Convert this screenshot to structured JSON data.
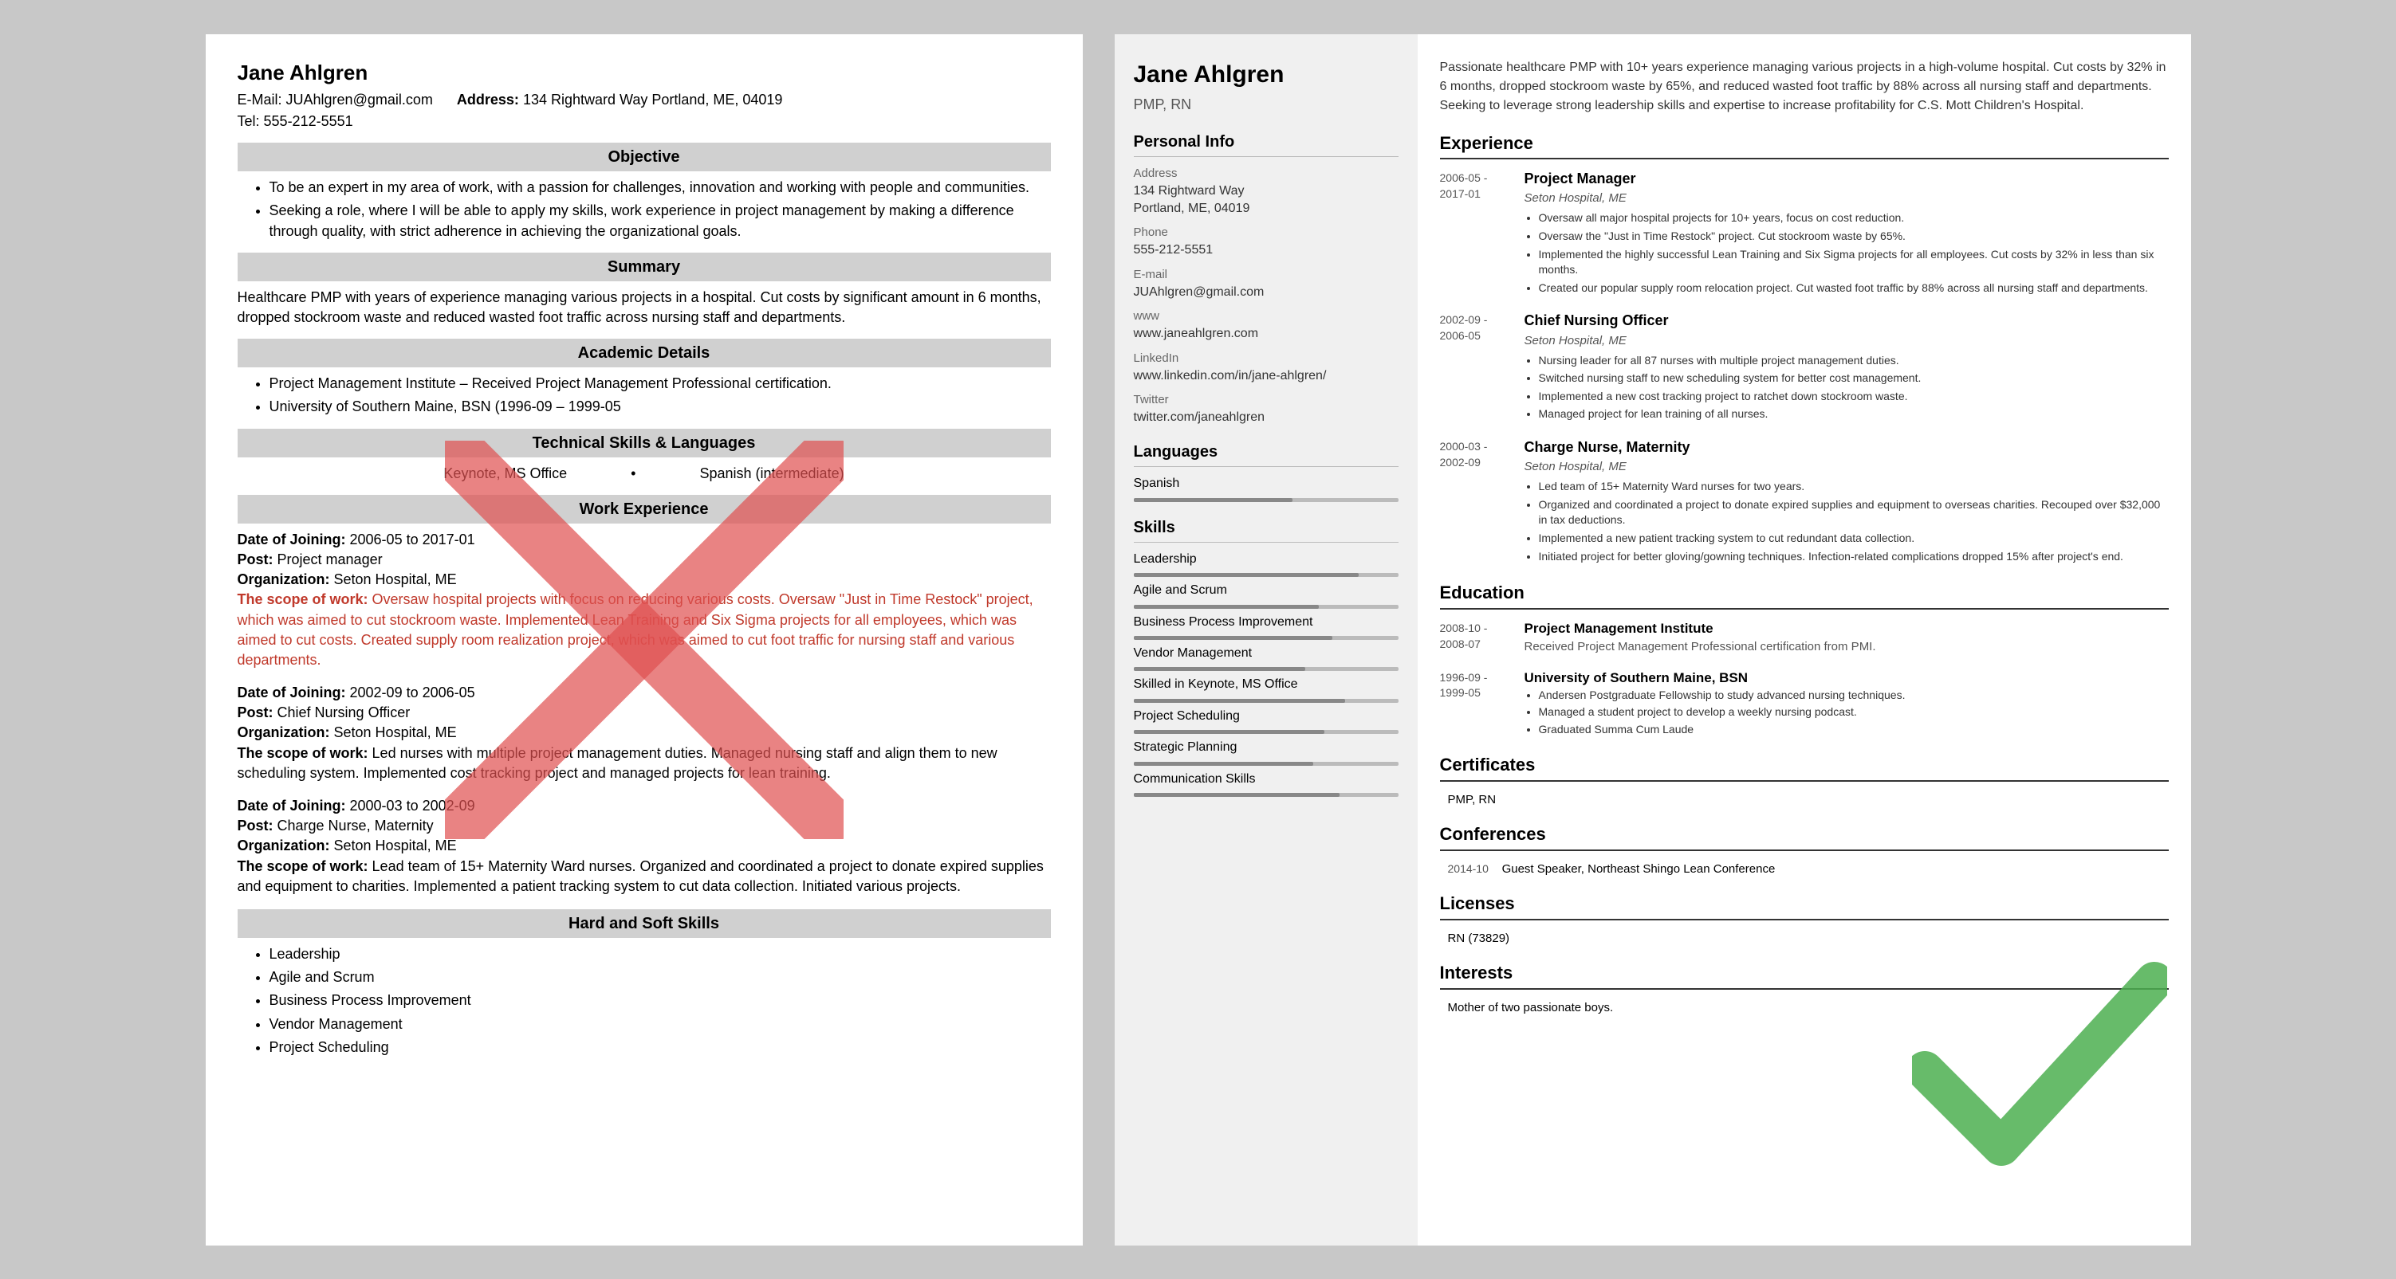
{
  "left_resume": {
    "name": "Jane Ahlgren",
    "email_label": "E-Mail:",
    "email": "JUAhlgren@gmail.com",
    "address_label": "Address:",
    "address": "134 Rightward Way Portland, ME, 04019",
    "tel_label": "Tel:",
    "tel": "555-212-5551",
    "sections": {
      "objective": {
        "header": "Objective",
        "bullets": [
          "To be an expert in my area of work, with a passion for challenges, innovation and working with people and communities.",
          "Seeking a role, where I will be able to apply my skills, work experience in project management by making a difference through quality, with strict adherence in achieving the organizational goals."
        ]
      },
      "summary": {
        "header": "Summary",
        "text": "Healthcare PMP with years of experience managing various projects in a hospital. Cut costs by significant amount in 6 months, dropped stockroom waste and reduced wasted foot traffic across nursing staff and departments."
      },
      "academic": {
        "header": "Academic Details",
        "bullets": [
          "Project Management Institute – Received Project Management Professional certification.",
          "University of Southern Maine, BSN (1996-09 – 1999-05"
        ]
      },
      "technical": {
        "header": "Technical Skills & Languages",
        "skill1": "Keynote, MS Office",
        "skill2": "Spanish (intermediate)"
      },
      "work": {
        "header": "Work Experience",
        "entries": [
          {
            "date_label": "Date of Joining:",
            "date": "2006-05 to 2017-01",
            "post_label": "Post:",
            "post": "Project manager",
            "org_label": "Organization:",
            "org": "Seton Hospital, ME",
            "scope_label": "The scope of work:",
            "scope": "Oversaw hospital projects with focus on reducing various costs. Oversaw \"Just in Time Restock\" project, which was aimed to cut stockroom waste. Implemented Lean Training and Six Sigma projects for all employees, which was aimed to cut costs. Created supply room realization project, which was aimed to cut foot traffic for nursing staff and various departments."
          },
          {
            "date_label": "Date of Joining:",
            "date": "2002-09 to 2006-05",
            "post_label": "Post:",
            "post": "Chief Nursing Officer",
            "org_label": "Organization:",
            "org": "Seton Hospital, ME",
            "scope_label": "The scope of work:",
            "scope": "Led nurses with multiple project management duties. Managed nursing staff and align them to new scheduling system. Implemented cost tracking project and managed projects for lean training."
          },
          {
            "date_label": "Date of Joining:",
            "date": "2000-03 to 2002-09",
            "post_label": "Post:",
            "post": "Charge Nurse, Maternity",
            "org_label": "Organization:",
            "org": "Seton Hospital, ME",
            "scope_label": "The scope of work:",
            "scope": "Lead team of 15+ Maternity Ward nurses. Organized and coordinated a project to donate expired supplies and equipment to charities. Implemented a patient tracking system to cut data collection. Initiated various projects."
          }
        ]
      },
      "skills": {
        "header": "Hard and Soft Skills",
        "bullets": [
          "Leadership",
          "Agile and Scrum",
          "Business Process Improvement",
          "Vendor Management",
          "Project Scheduling"
        ]
      }
    }
  },
  "right_resume": {
    "name": "Jane Ahlgren",
    "title": "PMP, RN",
    "summary": "Passionate healthcare PMP with 10+ years experience managing various projects in a high-volume hospital. Cut costs by 32% in 6 months, dropped stockroom waste by 65%, and reduced wasted foot traffic by 88% across all nursing staff and departments. Seeking to leverage strong leadership skills and expertise to increase profitability for C.S. Mott Children's Hospital.",
    "sidebar": {
      "personal_info_title": "Personal Info",
      "address_label": "Address",
      "address": "134 Rightward Way\nPortland, ME, 04019",
      "phone_label": "Phone",
      "phone": "555-212-5551",
      "email_label": "E-mail",
      "email": "JUAhlgren@gmail.com",
      "www_label": "www",
      "www": "www.janeahlgren.com",
      "linkedin_label": "LinkedIn",
      "linkedin": "www.linkedin.com/in/jane-ahlgren/",
      "twitter_label": "Twitter",
      "twitter": "twitter.com/janeahlgren",
      "languages_title": "Languages",
      "languages": [
        {
          "name": "Spanish",
          "level": 60
        }
      ],
      "skills_title": "Skills",
      "skills": [
        {
          "name": "Leadership",
          "level": 85
        },
        {
          "name": "Agile and Scrum",
          "level": 70
        },
        {
          "name": "Business Process Improvement",
          "level": 75
        },
        {
          "name": "Vendor Management",
          "level": 65
        },
        {
          "name": "Skilled in Keynote, MS Office",
          "level": 80
        },
        {
          "name": "Project Scheduling",
          "level": 72
        },
        {
          "name": "Strategic Planning",
          "level": 68
        },
        {
          "name": "Communication Skills",
          "level": 78
        }
      ]
    },
    "main": {
      "experience_title": "Experience",
      "experiences": [
        {
          "date": "2006-05 -\n2017-01",
          "title": "Project Manager",
          "company": "Seton Hospital, ME",
          "bullets": [
            "Oversaw all major hospital projects for 10+ years, focus on cost reduction.",
            "Oversaw the \"Just in Time Restock\" project. Cut stockroom waste by 65%.",
            "Implemented the highly successful Lean Training and Six Sigma projects for all employees. Cut costs by 32% in less than six months.",
            "Created our popular supply room relocation project. Cut wasted foot traffic by 88% across all nursing staff and departments."
          ]
        },
        {
          "date": "2002-09 -\n2006-05",
          "title": "Chief Nursing Officer",
          "company": "Seton Hospital, ME",
          "bullets": [
            "Nursing leader for all 87 nurses with multiple project management duties.",
            "Switched nursing staff to new scheduling system for better cost management.",
            "Implemented a new cost tracking project to ratchet down stockroom waste.",
            "Managed project for lean training of all nurses."
          ]
        },
        {
          "date": "2000-03 -\n2002-09",
          "title": "Charge Nurse, Maternity",
          "company": "Seton Hospital, ME",
          "bullets": [
            "Led team of 15+ Maternity Ward nurses for two years.",
            "Organized and coordinated a project to donate expired supplies and equipment to overseas charities. Recouped over $32,000 in tax deductions.",
            "Implemented a new patient tracking system to cut redundant data collection.",
            "Initiated project for better gloving/gowning techniques. Infection-related complications dropped 15% after project's end."
          ]
        }
      ],
      "education_title": "Education",
      "education": [
        {
          "date": "2008-10 -\n2008-07",
          "inst": "Project Management Institute",
          "degree": "Received Project Management Professional certification from PMI.",
          "bullets": []
        },
        {
          "date": "1996-09 -\n1999-05",
          "inst": "University of Southern Maine, BSN",
          "degree": "",
          "bullets": [
            "Andersen Postgraduate Fellowship to study advanced nursing techniques.",
            "Managed a student project to develop a weekly nursing podcast.",
            "Graduated Summa Cum Laude"
          ]
        }
      ],
      "certificates_title": "Certificates",
      "certificates": [
        "PMP, RN"
      ],
      "conferences_title": "Conferences",
      "conferences": [
        {
          "date": "2014-10",
          "text": "Guest Speaker, Northeast Shingo Lean Conference"
        }
      ],
      "licenses_title": "Licenses",
      "licenses": [
        "RN (73829)"
      ],
      "interests_title": "Interests",
      "interests": [
        "Mother of two passionate boys."
      ]
    }
  }
}
